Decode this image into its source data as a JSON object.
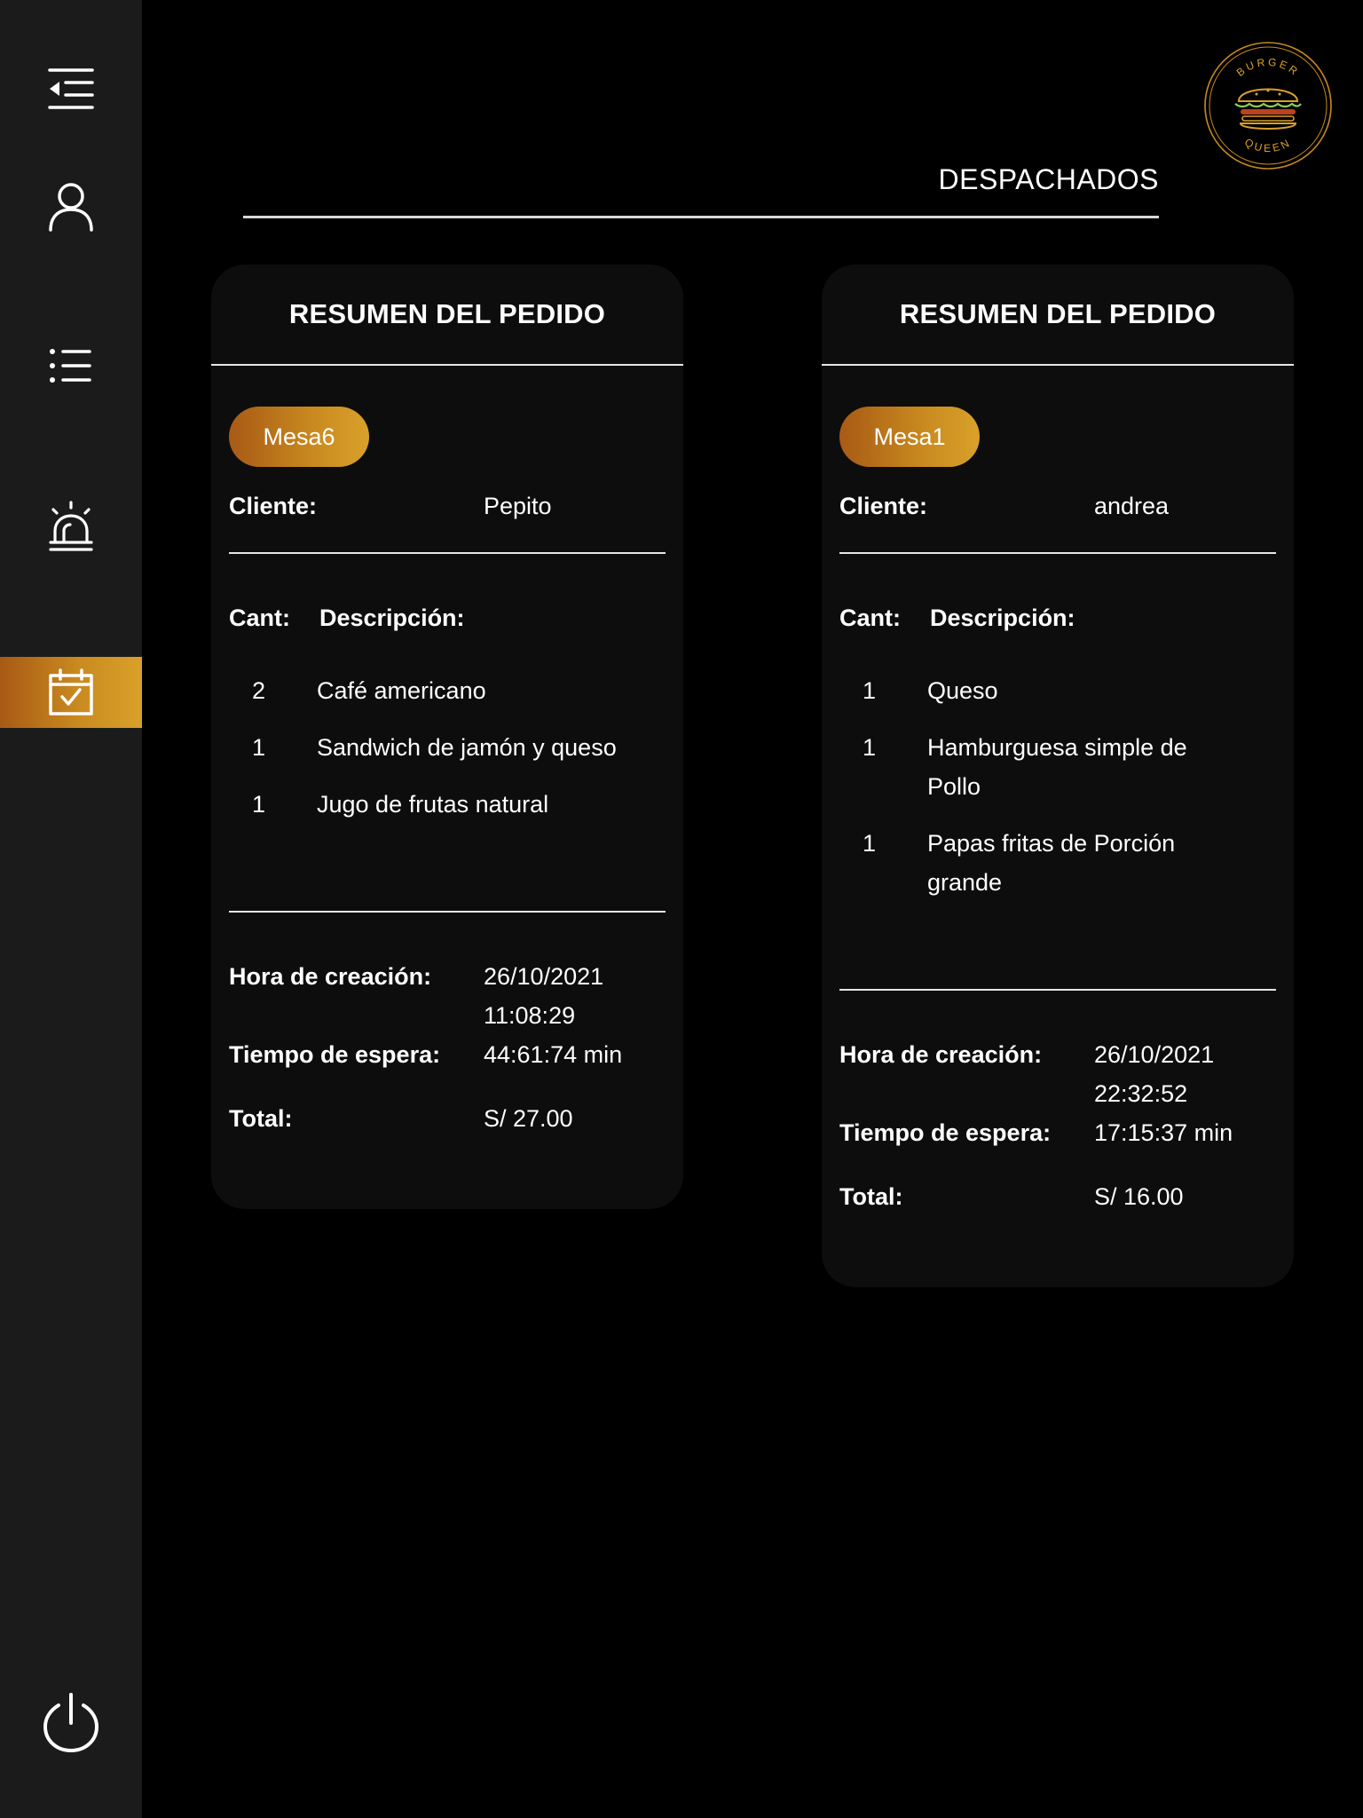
{
  "sidebar": {
    "items": [
      {
        "icon": "menu-collapse-icon"
      },
      {
        "icon": "user-icon"
      },
      {
        "icon": "list-icon"
      },
      {
        "icon": "alarm-bell-icon"
      },
      {
        "icon": "calendar-check-icon",
        "active": true
      },
      {
        "icon": "power-icon"
      }
    ],
    "active_color": "#c98a1f",
    "background": "#1b1b1b"
  },
  "logo": {
    "top_text": "BURGER",
    "bottom_text": "QUEEN",
    "icon": "burger-logo"
  },
  "section": {
    "title": "DESPACHADOS"
  },
  "orders": [
    {
      "header": "RESUMEN DEL PEDIDO",
      "table": "Mesa6",
      "client_label": "Cliente:",
      "client": "Pepito",
      "qty_label": "Cant:",
      "desc_label": "Descripción:",
      "items": [
        {
          "qty": "2",
          "desc": "Café americano"
        },
        {
          "qty": "1",
          "desc": "Sandwich de jamón y queso"
        },
        {
          "qty": "1",
          "desc": "Jugo de frutas natural"
        }
      ],
      "created_label": "Hora de creación:",
      "created": "26/10/2021 11:08:29",
      "wait_label": "Tiempo de espera:",
      "wait": "44:61:74 min",
      "total_label": "Total:",
      "total": "S/ 27.00"
    },
    {
      "header": "RESUMEN DEL PEDIDO",
      "table": "Mesa1",
      "client_label": "Cliente:",
      "client": "andrea",
      "qty_label": "Cant:",
      "desc_label": "Descripción:",
      "items": [
        {
          "qty": "1",
          "desc": "Queso"
        },
        {
          "qty": "1",
          "desc": "Hamburguesa simple de Pollo"
        },
        {
          "qty": "1",
          "desc": "Papas fritas de Porción grande"
        }
      ],
      "created_label": "Hora de creación:",
      "created": "26/10/2021 22:32:52",
      "wait_label": "Tiempo de espera:",
      "wait": "17:15:37 min",
      "total_label": "Total:",
      "total": "S/ 16.00"
    }
  ]
}
